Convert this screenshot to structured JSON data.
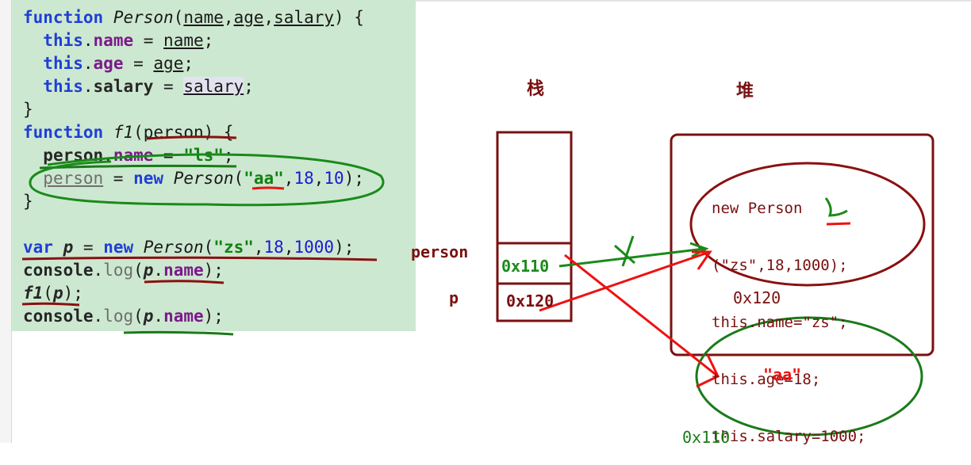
{
  "code": {
    "l1": {
      "t1": "function",
      "t2": "Person",
      "t3": "(",
      "t4": "name",
      "t5": ",",
      "t6": "age",
      "t7": ",",
      "t8": "salary",
      "t9": ") {"
    },
    "l2": {
      "t1": "this",
      "t2": ".",
      "t3": "name",
      "t4": " = ",
      "t5": "name",
      "t6": ";"
    },
    "l3": {
      "t1": "this",
      "t2": ".",
      "t3": "age",
      "t4": " = ",
      "t5": "age",
      "t6": ";"
    },
    "l4": {
      "t1": "this",
      "t2": ".",
      "t3": "salary",
      "t4": " = ",
      "t5": "salary",
      "t6": ";"
    },
    "l5": {
      "t1": "}"
    },
    "l6": {
      "t1": "function",
      "t2": "f1",
      "t3": "(",
      "t4": "person",
      "t5": ") {"
    },
    "l7": {
      "t1": "person",
      "t2": ".",
      "t3": "name",
      "t4": " = ",
      "t5": "\"ls\"",
      "t6": ";"
    },
    "l8": {
      "t1": "person",
      "t2": " = ",
      "t3": "new",
      "t4": "Person",
      "t5": "(",
      "t6": "\"aa\"",
      "t7": ",",
      "t8": "18",
      "t9": ",",
      "t10": "10",
      "t11": ");"
    },
    "l9": {
      "t1": "}"
    },
    "l10": {
      "t1": "var",
      "t2": "p",
      "t3": " = ",
      "t4": "new",
      "t5": "Person",
      "t6": "(",
      "t7": "\"zs\"",
      "t8": ",",
      "t9": "18",
      "t10": ",",
      "t11": "1000",
      "t12": ");"
    },
    "l11": {
      "t1": "console",
      "t2": ".",
      "t3": "log",
      "t4": "(",
      "t5": "p",
      "t6": ".",
      "t7": "name",
      "t8": ");"
    },
    "l12": {
      "t1": "f1",
      "t2": "(",
      "t3": "p",
      "t4": ");"
    },
    "l13": {
      "t1": "console",
      "t2": ".",
      "t3": "log",
      "t4": "(",
      "t5": "p",
      "t6": ".",
      "t7": "name",
      "t8": ");"
    }
  },
  "diagram": {
    "stack_title": "栈",
    "heap_title": "堆",
    "var_person": "person",
    "var_p": "p",
    "stack_person_value": "0x110",
    "stack_p_value": "0x120",
    "heap_obj_lines": [
      "new Person",
      "(\"zs\",18,1000);",
      "this.name=\"zs\";",
      "this.age=18;",
      "this.salary=1000;"
    ],
    "heap_obj_addr": "0x120",
    "heap_new_obj_text": "\"aa\"",
    "heap_new_obj_addr": "0x110"
  },
  "colors": {
    "code_bg": "#cde8d0",
    "keyword": "#1f3fd6",
    "diagram_dark_red": "#7a1010",
    "annotation_red": "#ee1111",
    "annotation_green": "#1a8a1a"
  },
  "icons": [
    "cross-mark-icon"
  ]
}
